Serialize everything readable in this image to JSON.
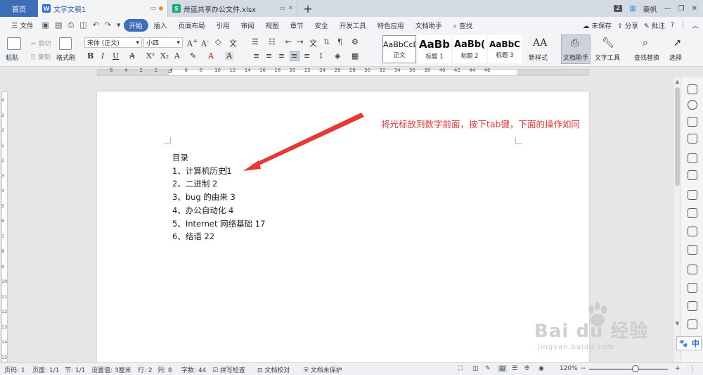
{
  "tabs": {
    "home": "首页",
    "doc": "文字文稿1",
    "sheet": "卅蓝共享办公文件.xlsx",
    "window_count": "2",
    "user": "蓑帆"
  },
  "menu": {
    "file": "三 文件",
    "items": [
      "开始",
      "插入",
      "页面布局",
      "引用",
      "审阅",
      "视图",
      "章节",
      "安全",
      "开发工具",
      "特色应用",
      "文档助手"
    ],
    "search": "查找",
    "unsaved": "未保存",
    "share": "分享",
    "comment": "批注"
  },
  "ribbon": {
    "paste": "粘贴",
    "cut": "剪切",
    "copy": "复制",
    "format_painter": "格式刷",
    "font_name": "宋体 (正文)",
    "font_size": "小四",
    "styles": [
      {
        "preview": "AaBbCcD",
        "name": "正文"
      },
      {
        "preview": "AaBb",
        "name": "标题 1"
      },
      {
        "preview": "AaBb(",
        "name": "标题 2"
      },
      {
        "preview": "AaBbC",
        "name": "标题 3"
      }
    ],
    "new_style": "新样式",
    "doc_assistant": "文档助手",
    "text_tools": "文字工具",
    "find_replace": "查找替换",
    "select": "选择"
  },
  "ruler": {
    "h_ticks": [
      "6",
      "4",
      "2",
      "2",
      "4",
      "6",
      "8",
      "10",
      "12",
      "14",
      "16",
      "18",
      "20",
      "22",
      "24",
      "26",
      "28",
      "30",
      "32",
      "34",
      "36",
      "38",
      "40",
      "42",
      "44",
      "46"
    ],
    "v_ticks": [
      "4",
      "2",
      "2",
      "1",
      "2",
      "3",
      "4",
      "5",
      "6",
      "7",
      "8",
      "9",
      "10",
      "11",
      "12",
      "13",
      "14",
      "15"
    ]
  },
  "document": {
    "toc_title": "目录",
    "lines": [
      "1、计算机历史",
      "2、二进制 2",
      "3、bug 的由来 3",
      "4、办公自动化 4",
      "5、Internet 网络基础 17",
      "6、结语 22"
    ],
    "line1_page": "1",
    "annotation": "将光标放到数字前面，按下tab键，下面的操作如同",
    "annotation_color": "#e53935"
  },
  "status": {
    "page_num": "页码: 1",
    "pages": "页面: 1/1",
    "section": "节: 1/1",
    "setting": "设置值: 3厘米",
    "row": "行: 2",
    "col": "列: 8",
    "words": "字数: 44",
    "spell": "拼写检查",
    "proof": "文档校对",
    "protect": "文档未保护",
    "zoom": "120%"
  },
  "watermark": {
    "brand": "Bai du 经验",
    "url": "jingyan.baidu.com",
    "ime": "中"
  },
  "colors": {
    "accent": "#3d6fb8",
    "annotation": "#e53935",
    "wps_doc": "#2b6ee0",
    "wps_sheet": "#1aa86b"
  }
}
